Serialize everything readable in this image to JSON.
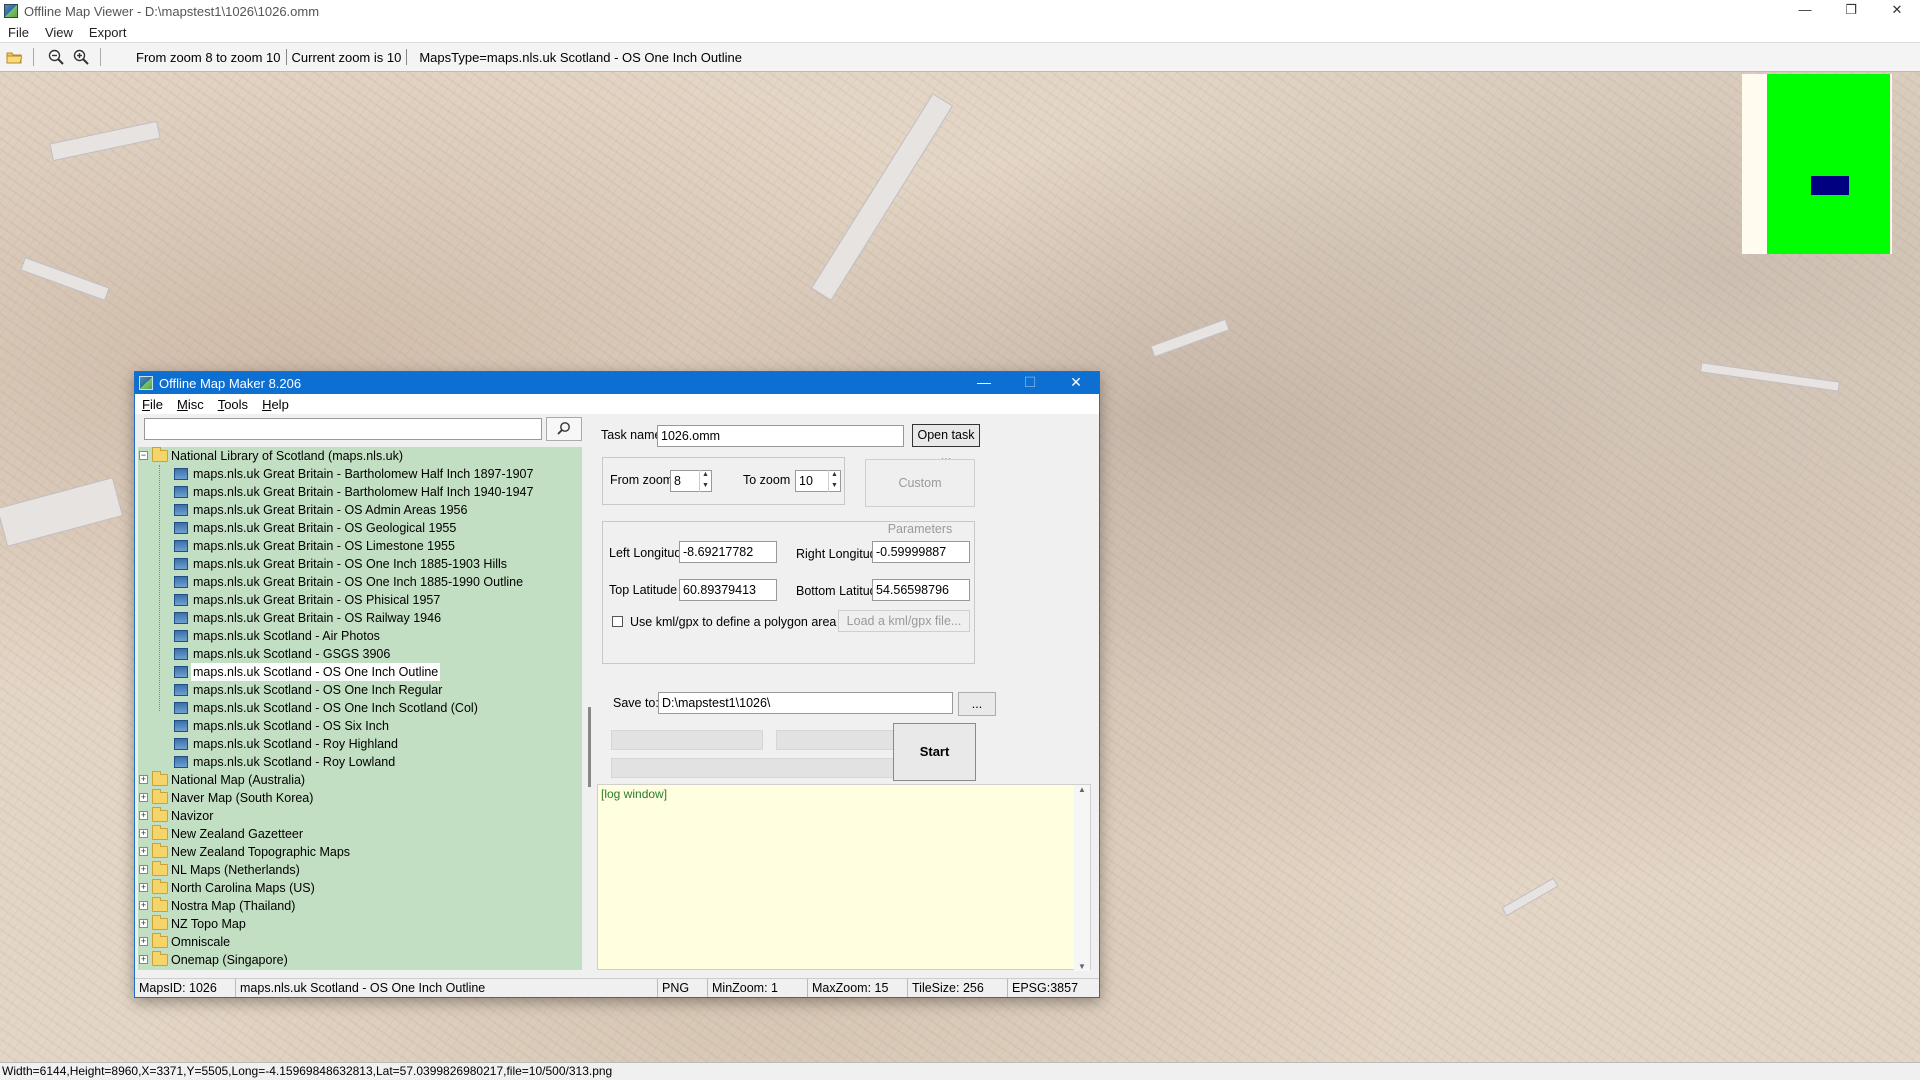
{
  "app": {
    "title": "Offline Map Viewer - D:\\mapstest1\\1026\\1026.omm",
    "controls": {
      "minimize": "—",
      "restore": "❐",
      "close": "✕"
    }
  },
  "menubar": [
    "File",
    "View",
    "Export"
  ],
  "toolbar": {
    "zoom_range": "From zoom 8 to zoom 10",
    "current_zoom": "Current zoom is 10",
    "maps_type": "MapsType=maps.nls.uk Scotland - OS One Inch Outline"
  },
  "overview": {
    "frame_color": "#00ff00",
    "viewport_color": "#000080"
  },
  "statusbar": "Width=6144,Height=8960,X=3371,Y=5505,Long=-4.15969848632813,Lat=57.0399826980217,file=10/500/313.png",
  "dialog": {
    "title": "Offline Map Maker 8.206",
    "controls": {
      "minimize": "—",
      "maximize": "☐",
      "close": "✕"
    },
    "menu": [
      {
        "pre": "",
        "u": "F",
        "post": "ile"
      },
      {
        "pre": "",
        "u": "M",
        "post": "isc"
      },
      {
        "pre": "",
        "u": "T",
        "post": "ools"
      },
      {
        "pre": "",
        "u": "H",
        "post": "elp"
      }
    ],
    "search": {
      "value": ""
    },
    "tree": {
      "root": "National Library of Scotland (maps.nls.uk)",
      "children": [
        "maps.nls.uk Great Britain - Bartholomew Half Inch 1897-1907",
        "maps.nls.uk Great Britain - Bartholomew Half Inch 1940-1947",
        "maps.nls.uk Great Britain - OS Admin Areas 1956",
        "maps.nls.uk Great Britain - OS Geological 1955",
        "maps.nls.uk Great Britain - OS Limestone 1955",
        "maps.nls.uk Great Britain - OS One Inch 1885-1903 Hills",
        "maps.nls.uk Great Britain - OS One Inch 1885-1990 Outline",
        "maps.nls.uk Great Britain - OS Phisical 1957",
        "maps.nls.uk Great Britain - OS Railway 1946",
        "maps.nls.uk Scotland - Air Photos",
        "maps.nls.uk Scotland - GSGS 3906",
        "maps.nls.uk Scotland - OS One Inch Outline",
        "maps.nls.uk Scotland - OS One Inch Regular",
        "maps.nls.uk Scotland - OS One Inch Scotland (Col)",
        "maps.nls.uk Scotland - OS Six Inch",
        "maps.nls.uk Scotland - Roy Highland",
        "maps.nls.uk Scotland - Roy Lowland"
      ],
      "selected": "maps.nls.uk Scotland - OS One Inch Outline",
      "folders": [
        "National Map (Australia)",
        "Naver Map (South Korea)",
        "Navizor",
        "New Zealand Gazetteer",
        "New Zealand Topographic Maps",
        "NL Maps (Netherlands)",
        "North Carolina Maps (US)",
        "Nostra Map (Thailand)",
        "NZ Topo Map",
        "Omniscale",
        "Onemap (Singapore)"
      ]
    },
    "form": {
      "task_name_label": "Task name",
      "task_name_value": "1026.omm",
      "open_task_button": "Open task ...",
      "from_zoom_label": "From zoom",
      "from_zoom_value": "8",
      "to_zoom_label": "To zoom",
      "to_zoom_value": "10",
      "custom_params_button": "Custom Parameters",
      "left_long_label": "Left Longitude",
      "left_long_value": "-8.69217782",
      "right_long_label": "Right Longitude",
      "right_long_value": "-0.59999887",
      "top_lat_label": "Top Latitude",
      "top_lat_value": "60.89379413",
      "bottom_lat_label": "Bottom Latitude",
      "bottom_lat_value": "54.56598796",
      "kml_checkbox_label": "Use kml/gpx to define a polygon area",
      "kml_checked": false,
      "load_kml_button": "Load a kml/gpx file...",
      "save_to_label": "Save to:",
      "save_to_value": "D:\\mapstest1\\1026\\",
      "browse_button": "...",
      "start_button": "Start",
      "log_text": "[log window]"
    },
    "status": {
      "maps_id": "MapsID: 1026",
      "maps_name": "maps.nls.uk Scotland - OS One Inch Outline",
      "format": "PNG",
      "min_zoom": "MinZoom: 1",
      "max_zoom": "MaxZoom: 15",
      "tile_size": "TileSize: 256",
      "epsg": "EPSG:3857"
    }
  }
}
